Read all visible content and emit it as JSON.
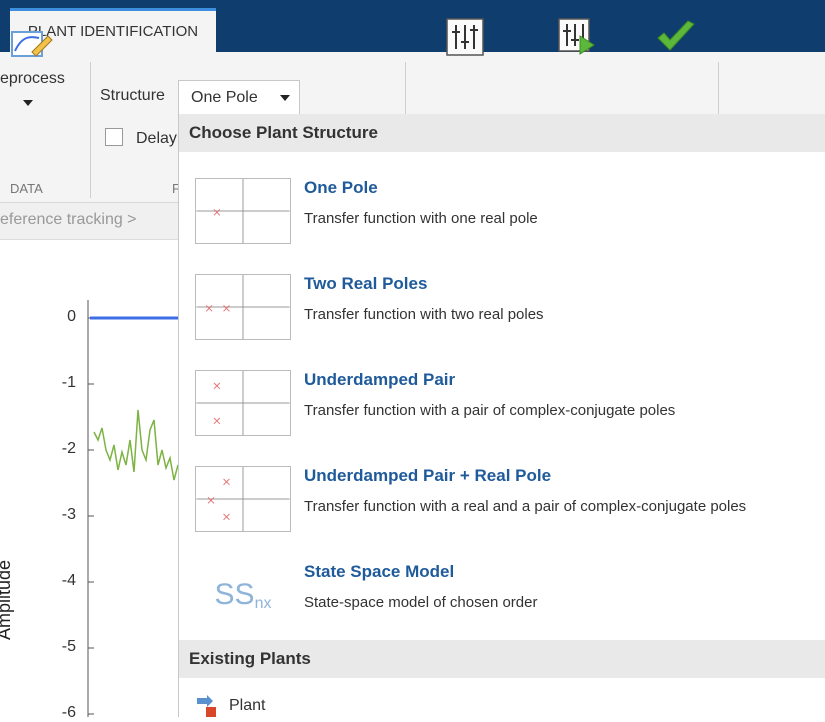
{
  "tabbar": {
    "tab_label": "PLANT IDENTIFICATION"
  },
  "toolstrip": {
    "preprocess_label": "eprocess",
    "data_section_label": "DATA",
    "structure_label": "Structure",
    "structure_value": "One Pole",
    "delay_label": "Delay",
    "second_section_label_fragment": "F"
  },
  "breadcrumb": {
    "text": "eference tracking  >"
  },
  "plot": {
    "ylabel": "Amplitude",
    "yticks": [
      "0",
      "-1",
      "-2",
      "-3",
      "-4",
      "-5",
      "-6"
    ]
  },
  "dropdown": {
    "header": "Choose Plant Structure",
    "options": [
      {
        "title": "One Pole",
        "desc": "Transfer function with one real pole"
      },
      {
        "title": "Two Real Poles",
        "desc": "Transfer function with two real poles"
      },
      {
        "title": "Underdamped Pair",
        "desc": "Transfer function with a pair of complex-conjugate poles"
      },
      {
        "title": "Underdamped Pair + Real Pole",
        "desc": "Transfer function with a real and a pair of complex-conjugate poles"
      },
      {
        "title": "State Space Model",
        "desc": "State-space model of chosen order"
      }
    ],
    "ss_icon_main": "SS",
    "ss_icon_sub": "nx",
    "existing_header": "Existing Plants",
    "existing_items": [
      {
        "label": "Plant"
      }
    ]
  },
  "colors": {
    "title_bar": "#0f3e6e",
    "tab_accent": "#3e8ee0",
    "link_blue": "#1f5a9a",
    "pole_marker": "#e57373",
    "reference_line": "#3d6ee6",
    "response_line": "#7cb342",
    "accept_green": "#5cb83a"
  },
  "icons": {
    "preprocess": "preprocess-icon",
    "tune": "tune-icon",
    "tune_run": "tune-run-icon",
    "accept": "checkmark-icon",
    "plant": "plant-icon"
  }
}
